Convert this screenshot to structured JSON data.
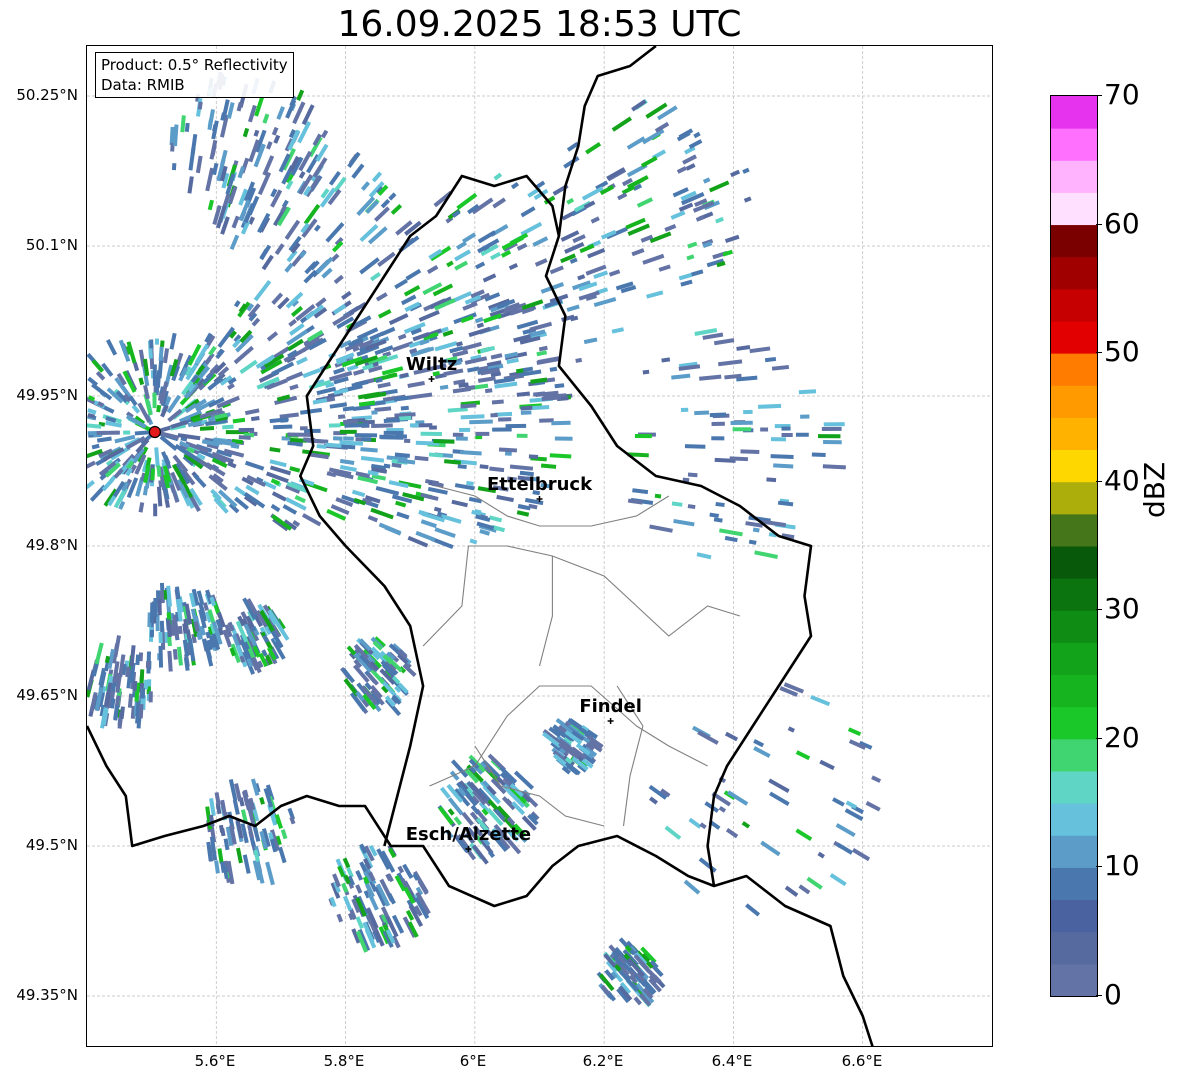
{
  "title": "16.09.2025 18:53 UTC",
  "info_box": {
    "product": "Product: 0.5° Reflectivity",
    "data": "Data: RMIB"
  },
  "axes": {
    "lat_ticks": [
      "50.25°N",
      "50.1°N",
      "49.95°N",
      "49.8°N",
      "49.65°N",
      "49.5°N",
      "49.35°N"
    ],
    "lon_ticks": [
      "5.6°E",
      "5.8°E",
      "6°E",
      "6.2°E",
      "6.4°E",
      "6.6°E"
    ],
    "lat_range": [
      49.3,
      50.3
    ],
    "lon_range": [
      5.4,
      6.8
    ],
    "grid": true
  },
  "cities": [
    {
      "name": "Wiltz",
      "lon": 5.933,
      "lat": 49.967
    },
    {
      "name": "Ettelbruck",
      "lon": 6.1,
      "lat": 49.847
    },
    {
      "name": "Findel",
      "lon": 6.21,
      "lat": 49.625
    },
    {
      "name": "Esch/Alzette",
      "lon": 5.99,
      "lat": 49.497
    }
  ],
  "radar_site": {
    "lon": 5.505,
    "lat": 49.914,
    "color": "#e31a1c"
  },
  "colorbar": {
    "label": "dBZ",
    "min": 0,
    "max": 70,
    "ticks": [
      "0",
      "10",
      "20",
      "30",
      "40",
      "50",
      "60",
      "70"
    ],
    "colors": [
      "#6473a5",
      "#566a9f",
      "#4a62a0",
      "#4a78ae",
      "#5b9cc8",
      "#66c1dc",
      "#5fd6c5",
      "#40d570",
      "#1ac829",
      "#16b520",
      "#12a31a",
      "#0f8c14",
      "#0c740f",
      "#08590a",
      "#45761a",
      "#abae0b",
      "#ffd700",
      "#ffb300",
      "#ff9a00",
      "#ff7c00",
      "#e30000",
      "#c60000",
      "#a10000",
      "#7a0000",
      "#ffe0ff",
      "#ffb3ff",
      "#ff70ff",
      "#e633ee"
    ]
  },
  "radar_echoes": [
    {
      "lon": 5.5,
      "lat": 49.92,
      "r": 0.09,
      "density": 0.9
    },
    {
      "lon": 5.72,
      "lat": 49.93,
      "r": 0.12,
      "density": 0.55
    },
    {
      "lon": 5.95,
      "lat": 49.93,
      "r": 0.13,
      "density": 0.5
    },
    {
      "lon": 6.05,
      "lat": 50.05,
      "r": 0.12,
      "density": 0.3
    },
    {
      "lon": 5.75,
      "lat": 50.1,
      "r": 0.1,
      "density": 0.25
    },
    {
      "lon": 5.65,
      "lat": 50.2,
      "r": 0.08,
      "density": 0.3
    },
    {
      "lon": 5.55,
      "lat": 49.72,
      "r": 0.04,
      "density": 0.6
    },
    {
      "lon": 5.66,
      "lat": 49.71,
      "r": 0.03,
      "density": 0.55
    },
    {
      "lon": 5.85,
      "lat": 49.67,
      "r": 0.035,
      "density": 0.55
    },
    {
      "lon": 6.02,
      "lat": 49.54,
      "r": 0.05,
      "density": 0.55
    },
    {
      "lon": 6.15,
      "lat": 49.6,
      "r": 0.025,
      "density": 0.6
    },
    {
      "lon": 5.85,
      "lat": 49.45,
      "r": 0.05,
      "density": 0.45
    },
    {
      "lon": 6.24,
      "lat": 49.37,
      "r": 0.03,
      "density": 0.6
    },
    {
      "lon": 6.28,
      "lat": 50.15,
      "r": 0.1,
      "density": 0.2
    },
    {
      "lon": 6.4,
      "lat": 49.9,
      "r": 0.12,
      "density": 0.15
    },
    {
      "lon": 6.45,
      "lat": 49.55,
      "r": 0.12,
      "density": 0.08
    },
    {
      "lon": 5.45,
      "lat": 49.66,
      "r": 0.04,
      "density": 0.5
    },
    {
      "lon": 5.65,
      "lat": 49.51,
      "r": 0.05,
      "density": 0.35
    }
  ],
  "boundaries": {
    "country": [
      [
        [
          5.4,
          49.62
        ],
        [
          5.43,
          49.58
        ],
        [
          5.46,
          49.55
        ],
        [
          5.47,
          49.5
        ],
        [
          5.52,
          49.51
        ],
        [
          5.58,
          49.52
        ],
        [
          5.62,
          49.53
        ],
        [
          5.66,
          49.52
        ],
        [
          5.7,
          49.54
        ],
        [
          5.74,
          49.55
        ],
        [
          5.79,
          49.54
        ],
        [
          5.83,
          49.54
        ],
        [
          5.87,
          49.5
        ],
        [
          5.92,
          49.5
        ],
        [
          5.96,
          49.46
        ],
        [
          6.03,
          49.44
        ],
        [
          6.08,
          49.45
        ],
        [
          6.12,
          49.48
        ],
        [
          6.16,
          49.5
        ],
        [
          6.22,
          49.51
        ],
        [
          6.28,
          49.49
        ],
        [
          6.33,
          49.47
        ],
        [
          6.37,
          49.46
        ],
        [
          6.42,
          49.47
        ],
        [
          6.48,
          49.44
        ],
        [
          6.55,
          49.42
        ],
        [
          6.57,
          49.37
        ],
        [
          6.6,
          49.33
        ],
        [
          6.62,
          49.29
        ]
      ],
      [
        [
          5.86,
          49.5
        ],
        [
          5.88,
          49.55
        ],
        [
          5.9,
          49.6
        ],
        [
          5.92,
          49.66
        ],
        [
          5.9,
          49.72
        ],
        [
          5.86,
          49.76
        ],
        [
          5.8,
          49.8
        ],
        [
          5.76,
          49.83
        ],
        [
          5.73,
          49.87
        ],
        [
          5.75,
          49.9
        ],
        [
          5.74,
          49.95
        ],
        [
          5.78,
          49.99
        ],
        [
          5.82,
          50.03
        ],
        [
          5.86,
          50.07
        ],
        [
          5.9,
          50.11
        ],
        [
          5.94,
          50.13
        ],
        [
          5.98,
          50.17
        ],
        [
          6.03,
          50.16
        ],
        [
          6.08,
          50.17
        ],
        [
          6.12,
          50.14
        ],
        [
          6.13,
          50.11
        ],
        [
          6.11,
          50.07
        ],
        [
          6.14,
          50.03
        ],
        [
          6.13,
          49.98
        ],
        [
          6.18,
          49.94
        ],
        [
          6.22,
          49.9
        ],
        [
          6.28,
          49.87
        ],
        [
          6.35,
          49.86
        ],
        [
          6.41,
          49.84
        ],
        [
          6.47,
          49.81
        ],
        [
          6.52,
          49.8
        ],
        [
          6.51,
          49.75
        ],
        [
          6.52,
          49.71
        ],
        [
          6.47,
          49.66
        ],
        [
          6.43,
          49.62
        ],
        [
          6.39,
          49.58
        ],
        [
          6.37,
          49.55
        ],
        [
          6.36,
          49.5
        ],
        [
          6.37,
          49.46
        ]
      ],
      [
        [
          6.13,
          50.11
        ],
        [
          6.14,
          50.16
        ],
        [
          6.16,
          50.2
        ],
        [
          6.17,
          50.24
        ],
        [
          6.19,
          50.27
        ],
        [
          6.24,
          50.28
        ],
        [
          6.28,
          50.3
        ]
      ]
    ],
    "cantons": [
      [
        [
          5.94,
          49.86
        ],
        [
          6.0,
          49.85
        ],
        [
          6.05,
          49.83
        ],
        [
          6.1,
          49.82
        ],
        [
          6.18,
          49.82
        ],
        [
          6.25,
          49.83
        ],
        [
          6.3,
          49.85
        ]
      ],
      [
        [
          5.92,
          49.7
        ],
        [
          5.98,
          49.74
        ],
        [
          5.99,
          49.8
        ],
        [
          6.05,
          49.8
        ],
        [
          6.12,
          49.79
        ],
        [
          6.2,
          49.77
        ],
        [
          6.25,
          49.74
        ],
        [
          6.3,
          49.71
        ],
        [
          6.36,
          49.74
        ],
        [
          6.41,
          49.73
        ]
      ],
      [
        [
          5.93,
          49.56
        ],
        [
          6.0,
          49.58
        ],
        [
          6.05,
          49.63
        ],
        [
          6.1,
          49.66
        ],
        [
          6.18,
          49.66
        ],
        [
          6.25,
          49.62
        ],
        [
          6.3,
          49.6
        ],
        [
          6.36,
          49.58
        ]
      ],
      [
        [
          6.0,
          49.6
        ],
        [
          6.04,
          49.56
        ],
        [
          6.1,
          49.55
        ],
        [
          6.14,
          49.53
        ],
        [
          6.2,
          49.52
        ]
      ],
      [
        [
          6.22,
          49.66
        ],
        [
          6.26,
          49.62
        ],
        [
          6.24,
          49.57
        ],
        [
          6.23,
          49.52
        ]
      ],
      [
        [
          6.12,
          49.79
        ],
        [
          6.12,
          49.73
        ],
        [
          6.1,
          49.68
        ]
      ]
    ]
  }
}
